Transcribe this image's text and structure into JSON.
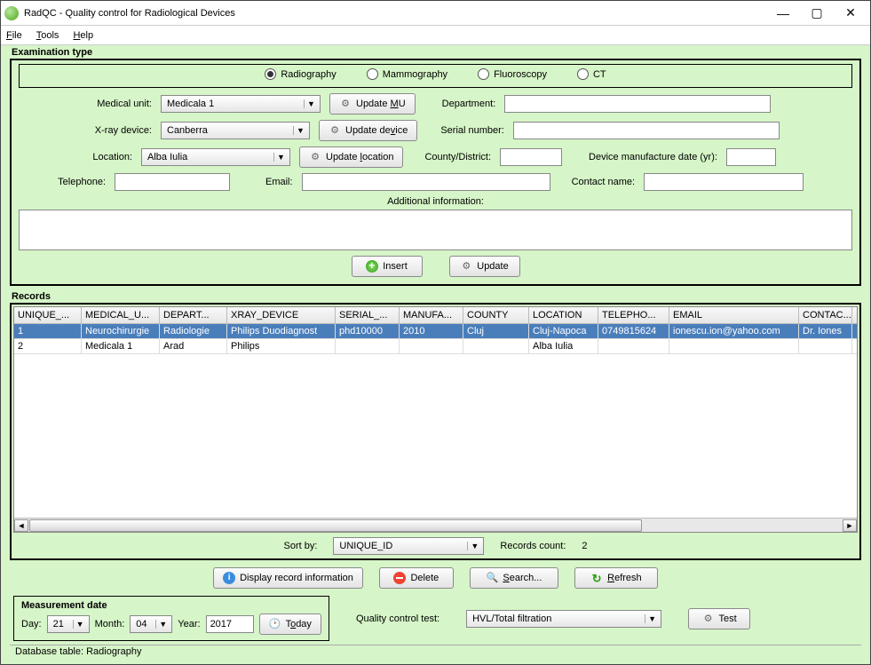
{
  "window": {
    "title": "RadQC - Quality control for Radiological Devices"
  },
  "menu": {
    "file": "File",
    "tools": "Tools",
    "help": "Help"
  },
  "examType": {
    "legend": "Examination type",
    "options": [
      "Radiography",
      "Mammography",
      "Fluoroscopy",
      "CT"
    ],
    "selected": "Radiography"
  },
  "form": {
    "medicalUnitLabel": "Medical unit:",
    "medicalUnitValue": "Medicala 1",
    "updateMU": "Update MU",
    "departmentLabel": "Department:",
    "departmentValue": "",
    "xrayDeviceLabel": "X-ray device:",
    "xrayDeviceValue": "Canberra",
    "updateDevice": "Update device",
    "serialNumberLabel": "Serial number:",
    "serialNumberValue": "",
    "locationLabel": "Location:",
    "locationValue": "Alba Iulia",
    "updateLocation": "Update location",
    "countyLabel": "County/District:",
    "countyValue": "",
    "mfgDateLabel": "Device manufacture date (yr):",
    "mfgDateValue": "",
    "telephoneLabel": "Telephone:",
    "telephoneValue": "",
    "emailLabel": "Email:",
    "emailValue": "",
    "contactLabel": "Contact name:",
    "contactValue": "",
    "additionalLabel": "Additional information:",
    "insert": "Insert",
    "update": "Update"
  },
  "records": {
    "legend": "Records",
    "columns": [
      "UNIQUE_...",
      "MEDICAL_U...",
      "DEPART...",
      "XRAY_DEVICE",
      "SERIAL_...",
      "MANUFA...",
      "COUNTY",
      "LOCATION",
      "TELEPHO...",
      "EMAIL",
      "CONTAC..."
    ],
    "rows": [
      {
        "selected": true,
        "cells": [
          "1",
          "Neurochirurgie",
          "Radiologie",
          "Philips Duodiagnost",
          "phd10000",
          "2010",
          "Cluj",
          "Cluj-Napoca",
          "0749815624",
          "ionescu.ion@yahoo.com",
          "Dr. Iones"
        ]
      },
      {
        "selected": false,
        "cells": [
          "2",
          "Medicala 1",
          "Arad",
          "Philips",
          "",
          "",
          "",
          "Alba Iulia",
          "",
          "",
          ""
        ]
      }
    ],
    "sortByLabel": "Sort by:",
    "sortByValue": "UNIQUE_ID",
    "countLabel": "Records count:",
    "countValue": "2"
  },
  "actions": {
    "display": "Display record information",
    "delete": "Delete",
    "search": "Search...",
    "refresh": "Refresh"
  },
  "measurement": {
    "legend": "Measurement date",
    "dayLabel": "Day:",
    "dayValue": "21",
    "monthLabel": "Month:",
    "monthValue": "04",
    "yearLabel": "Year:",
    "yearValue": "2017",
    "today": "Today"
  },
  "qc": {
    "label": "Quality control test:",
    "value": "HVL/Total filtration",
    "testBtn": "Test"
  },
  "status": "Database table: Radiography"
}
